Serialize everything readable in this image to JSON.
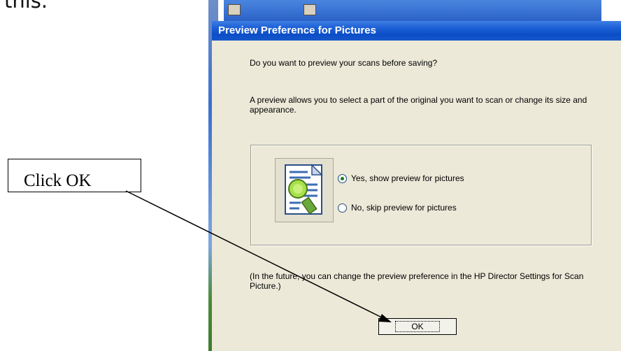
{
  "doc_fragment": "this.",
  "dialog": {
    "title": "Preview Preference for Pictures",
    "question": "Do you want to preview your scans before saving?",
    "description": "A preview allows you to select a part of the original you want to scan or change its size and appearance.",
    "options": [
      {
        "label": "Yes, show preview for pictures",
        "checked": true
      },
      {
        "label": "No, skip preview for pictures",
        "checked": false
      }
    ],
    "footer_note": "(In the future, you can change the preview preference in the HP Director Settings for Scan Picture.)",
    "ok_label": "OK"
  },
  "annotation": {
    "text": "Click OK",
    "target": "ok-button"
  },
  "colors": {
    "dialog_bg": "#ece9d8",
    "title_bar": "#0c4ec7",
    "title_text": "#ffffff"
  }
}
